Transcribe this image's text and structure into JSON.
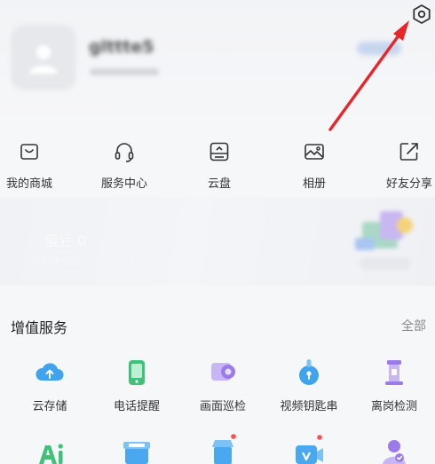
{
  "profile": {
    "username": "glttte5"
  },
  "quick_actions": [
    {
      "label": "我的商城",
      "icon": "mall-icon"
    },
    {
      "label": "服务中心",
      "icon": "headset-icon"
    },
    {
      "label": "云盘",
      "icon": "cloud-drive-icon"
    },
    {
      "label": "相册",
      "icon": "album-icon"
    },
    {
      "label": "好友分享",
      "icon": "share-icon"
    }
  ],
  "promo": {
    "beans_title": "萤豆 0",
    "beans_subtitle": "轻松赚萤豆，兑换抽豪礼"
  },
  "value_services": {
    "title": "增值服务",
    "more_label": "全部",
    "items": [
      {
        "label": "云存储",
        "icon": "cloud-storage-icon"
      },
      {
        "label": "电话提醒",
        "icon": "phone-alert-icon"
      },
      {
        "label": "画面巡检",
        "icon": "image-inspection-icon"
      },
      {
        "label": "视频钥匙串",
        "icon": "video-keychain-icon"
      },
      {
        "label": "离岗检测",
        "icon": "absence-detection-icon"
      }
    ],
    "more_items": [
      {
        "icon": "ai-icon"
      },
      {
        "icon": "ezviz-store-icon"
      },
      {
        "icon": "shop-icon"
      },
      {
        "icon": "video-call-icon"
      },
      {
        "icon": "user-verify-icon"
      }
    ]
  },
  "colors": {
    "accent_blue": "#3fa3ee",
    "arrow_red": "#e8262a",
    "badge_red": "#ff4d4f",
    "ai_green": "#3ec27a",
    "purple": "#9b7bea"
  }
}
